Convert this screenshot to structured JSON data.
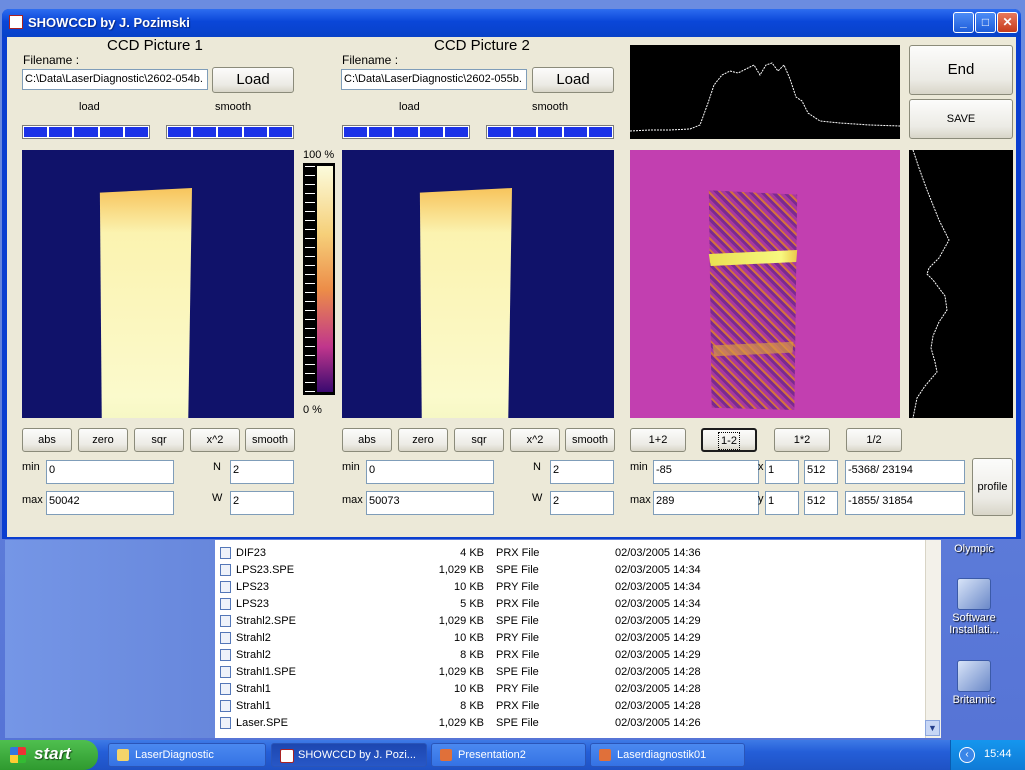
{
  "window": {
    "title": "SHOWCCD  by J. Pozimski",
    "min_label": "_",
    "max_label": "□",
    "close_label": "X"
  },
  "pic1": {
    "title": "CCD Picture 1",
    "filename_label": "Filename :",
    "filename": "C:\\Data\\LaserDiagnostic\\2602-054b.",
    "load_label": "Load",
    "load_progress_label": "load",
    "smooth_progress_label": "smooth",
    "buttons": [
      "abs",
      "zero",
      "sqr",
      "x^2",
      "smooth"
    ],
    "min_label": "min",
    "min": "0",
    "max_label": "max",
    "max": "50042",
    "n_label": "N",
    "n": "2",
    "w_label": "W",
    "w": "2"
  },
  "pic2": {
    "title": "CCD Picture 2",
    "filename_label": "Filename :",
    "filename": "C:\\Data\\LaserDiagnostic\\2602-055b.",
    "load_label": "Load",
    "load_progress_label": "load",
    "smooth_progress_label": "smooth",
    "buttons": [
      "abs",
      "zero",
      "sqr",
      "x^2",
      "smooth"
    ],
    "min_label": "min",
    "min": "0",
    "max_label": "max",
    "max": "50073",
    "n_label": "N",
    "n": "2",
    "w_label": "W",
    "w": "2"
  },
  "colorbar": {
    "top_label": "100 %",
    "bottom_label": "0 %"
  },
  "result": {
    "ops": [
      "1+2",
      "1-2",
      "1*2",
      "1/2"
    ],
    "min_label": "min",
    "min": "-85",
    "max_label": "max",
    "max": "289",
    "x_label": "x",
    "x1": "1",
    "x2": "512",
    "x_range": "-5368/ 23194",
    "y_label": "y",
    "y1": "1",
    "y2": "512",
    "y_range": "-1855/ 31854",
    "profile_label": "profile",
    "end_label": "End",
    "save_label": "SAVE"
  },
  "explorer": {
    "files": [
      {
        "name": "DIF23",
        "size": "4 KB",
        "type": "PRX File",
        "date": "02/03/2005 14:36"
      },
      {
        "name": "LPS23.SPE",
        "size": "1,029 KB",
        "type": "SPE File",
        "date": "02/03/2005 14:34"
      },
      {
        "name": "LPS23",
        "size": "10 KB",
        "type": "PRY File",
        "date": "02/03/2005 14:34"
      },
      {
        "name": "LPS23",
        "size": "5 KB",
        "type": "PRX File",
        "date": "02/03/2005 14:34"
      },
      {
        "name": "Strahl2.SPE",
        "size": "1,029 KB",
        "type": "SPE File",
        "date": "02/03/2005 14:29"
      },
      {
        "name": "Strahl2",
        "size": "10 KB",
        "type": "PRY File",
        "date": "02/03/2005 14:29"
      },
      {
        "name": "Strahl2",
        "size": "8 KB",
        "type": "PRX File",
        "date": "02/03/2005 14:29"
      },
      {
        "name": "Strahl1.SPE",
        "size": "1,029 KB",
        "type": "SPE File",
        "date": "02/03/2005 14:28"
      },
      {
        "name": "Strahl1",
        "size": "10 KB",
        "type": "PRY File",
        "date": "02/03/2005 14:28"
      },
      {
        "name": "Strahl1",
        "size": "8 KB",
        "type": "PRX File",
        "date": "02/03/2005 14:28"
      },
      {
        "name": "Laser.SPE",
        "size": "1,029 KB",
        "type": "SPE File",
        "date": "02/03/2005 14:26"
      }
    ]
  },
  "desktop_icons": [
    "Olympic",
    "Software Installati...",
    "Britannic"
  ],
  "taskbar": {
    "start_label": "start",
    "tasks": [
      "LaserDiagnostic",
      "SHOWCCD  by J. Pozi...",
      "Presentation2",
      "Laserdiagnostik01"
    ],
    "clock": "15:44"
  }
}
